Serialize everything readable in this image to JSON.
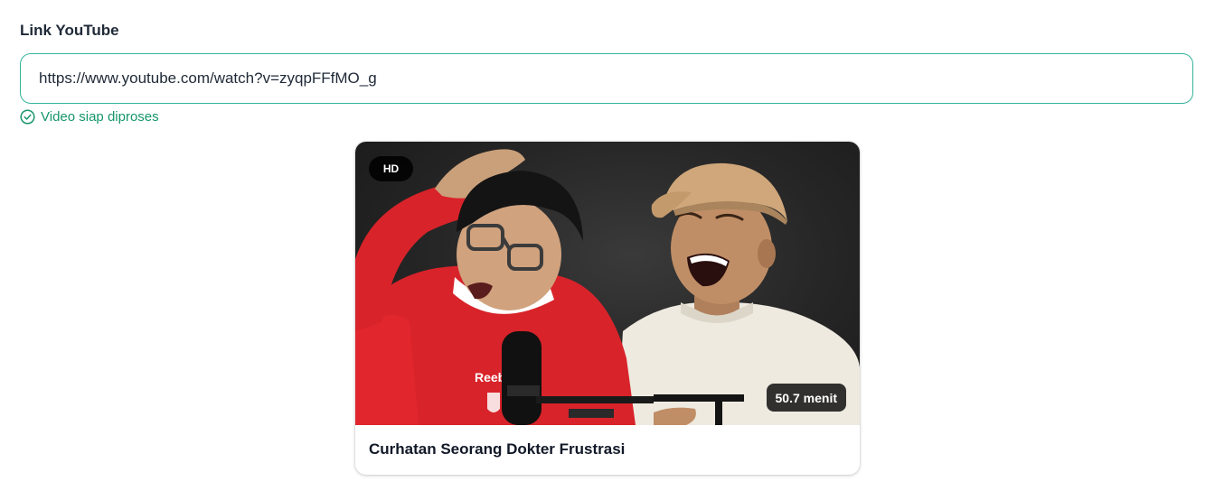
{
  "form": {
    "label": "Link YouTube",
    "url_value": "https://www.youtube.com/watch?v=zyqpFFfMO_g",
    "status_text": "Video siap diproses",
    "status_icon": "check-circle-icon",
    "accent_color": "#16966b"
  },
  "video": {
    "quality_badge": "HD",
    "duration": "50.7 menit",
    "title": "Curhatan Seorang Dokter Frustrasi",
    "thumbnail_logo_text": "Reeb"
  }
}
